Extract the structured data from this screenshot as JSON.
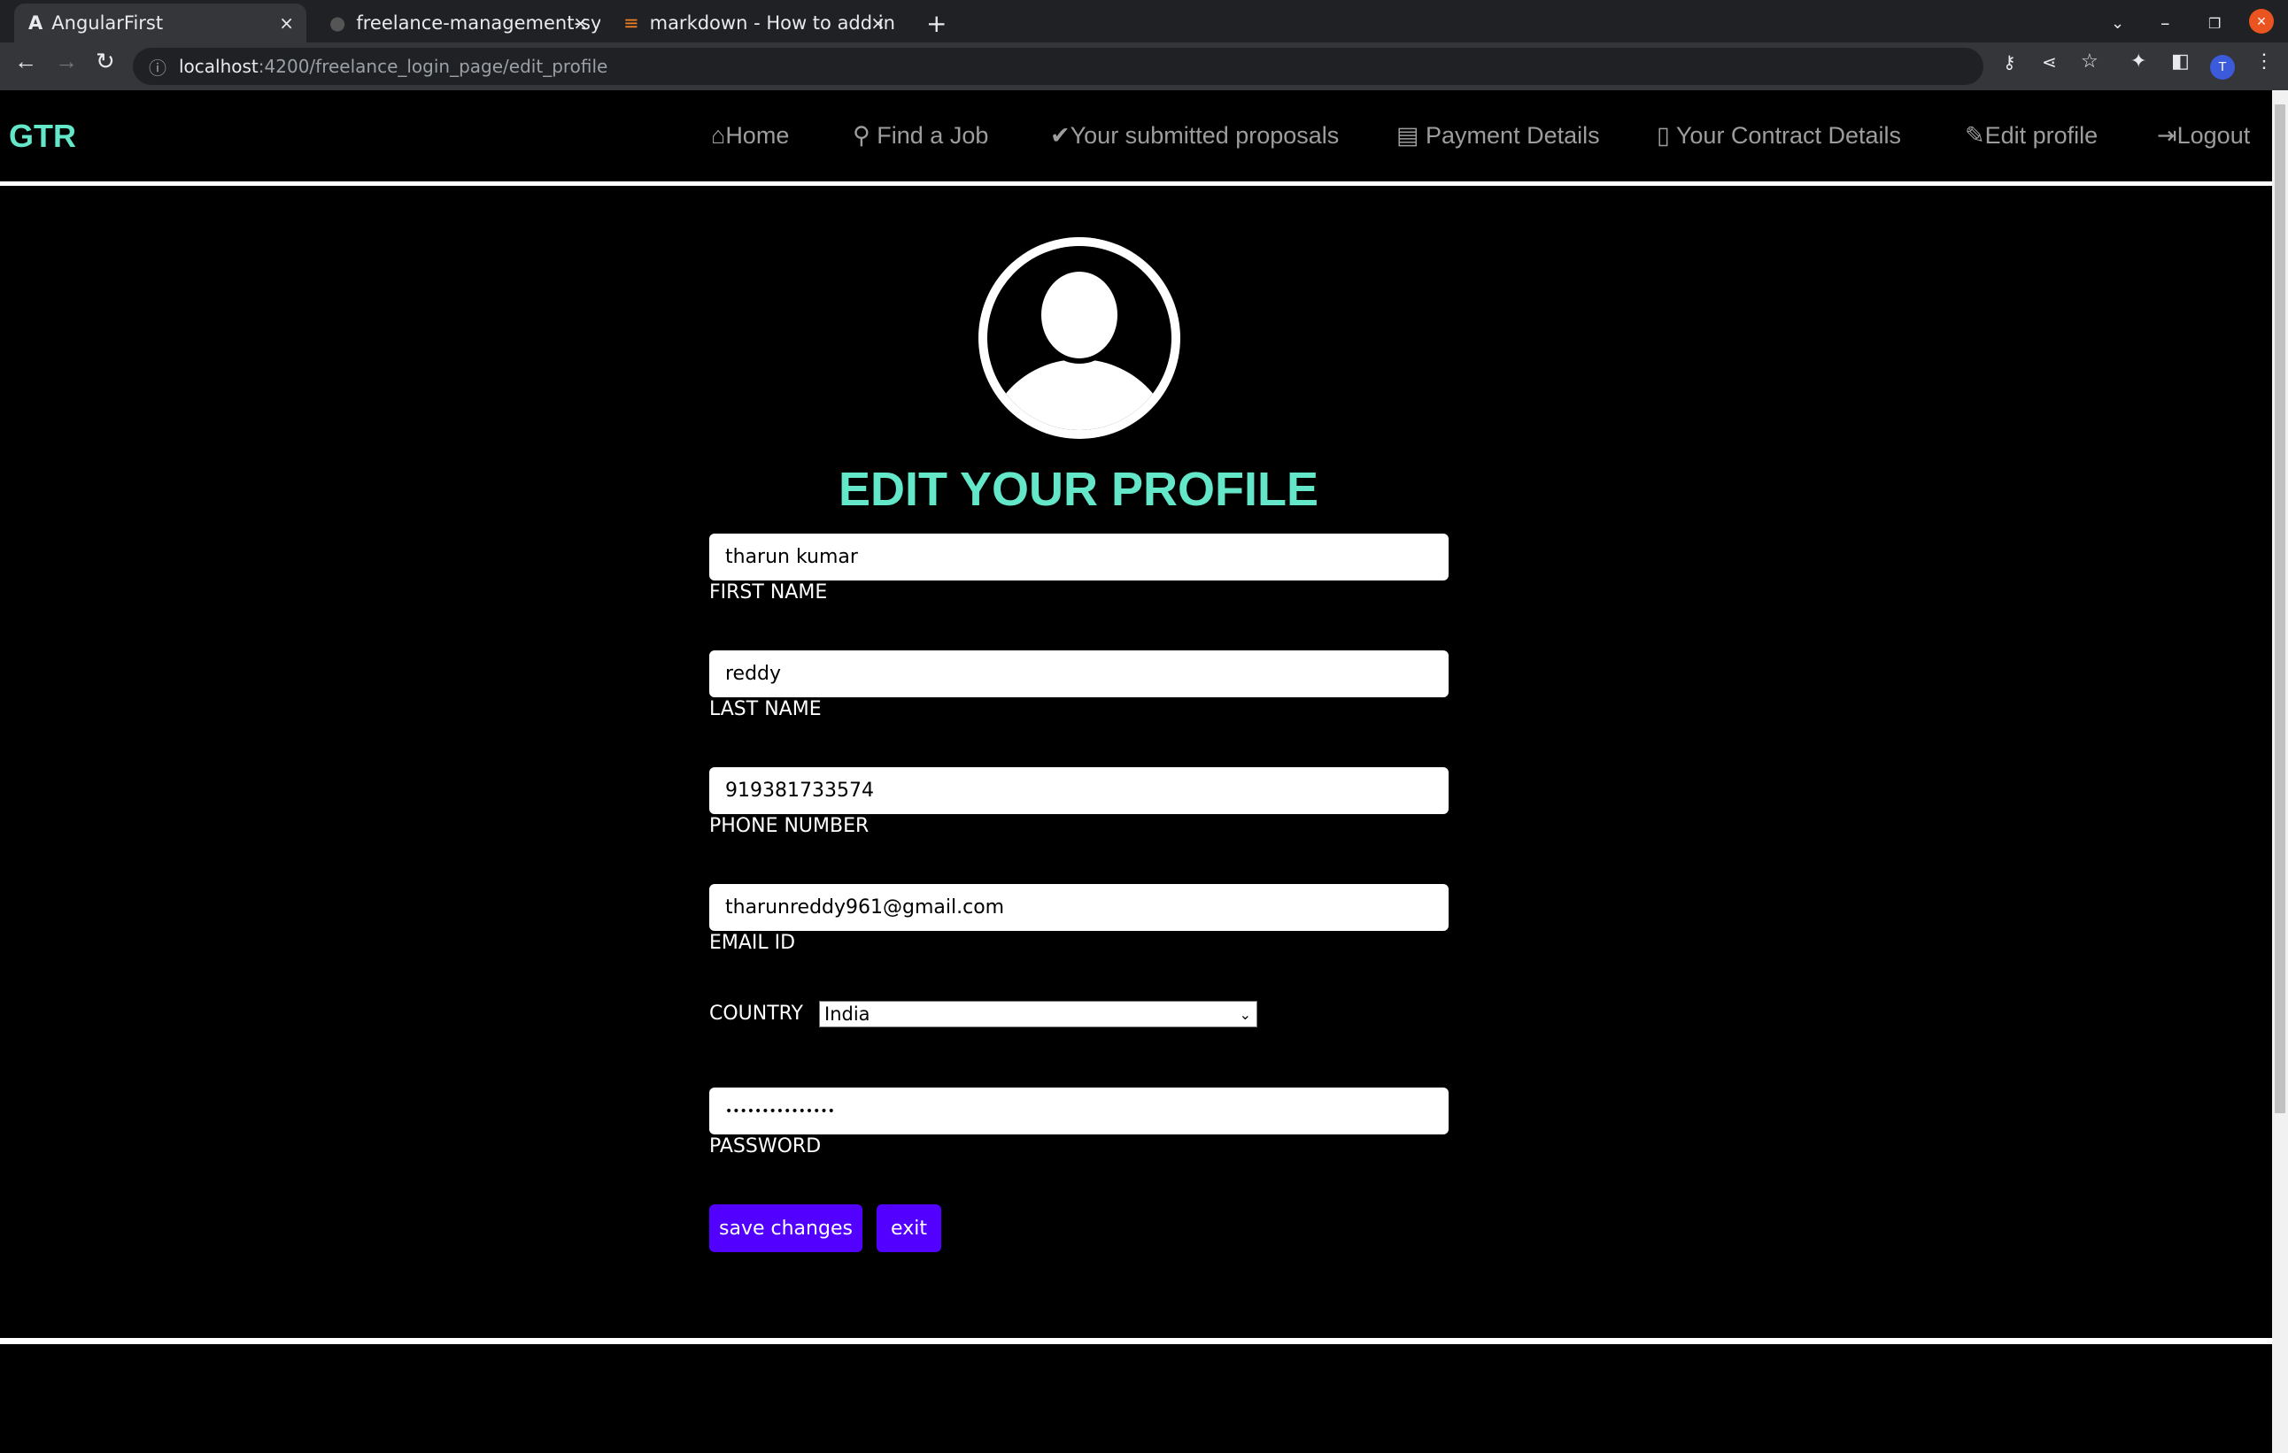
{
  "browser": {
    "tabs": [
      {
        "title": "AngularFirst"
      },
      {
        "title": "freelance-management-sy"
      },
      {
        "title": "markdown - How to add in"
      }
    ],
    "url_host": "localhost",
    "url_path": ":4200/freelance_login_page/edit_profile",
    "profile_initial": "T"
  },
  "nav": {
    "brand": "GTR",
    "items": [
      {
        "icon": "home-icon",
        "label": "Home"
      },
      {
        "icon": "search-icon",
        "label": "Find a Job"
      },
      {
        "icon": "check-icon",
        "label": "Your submitted proposals"
      },
      {
        "icon": "credit-card-icon",
        "label": "Payment Details"
      },
      {
        "icon": "file-icon",
        "label": "Your Contract Details"
      },
      {
        "icon": "edit-icon",
        "label": "Edit profile"
      },
      {
        "icon": "logout-icon",
        "label": "Logout"
      }
    ]
  },
  "form": {
    "title": "EDIT YOUR PROFILE",
    "first_name": {
      "value": "tharun kumar",
      "label": "FIRST NAME"
    },
    "last_name": {
      "value": "reddy",
      "label": "LAST NAME"
    },
    "phone": {
      "value": "919381733574",
      "label": "PHONE NUMBER"
    },
    "email": {
      "value": "tharunreddy961@gmail.com",
      "label": "EMAIL ID"
    },
    "country": {
      "label": "COUNTRY",
      "value": "India"
    },
    "password": {
      "value": "•••••••••••••••",
      "label": "PASSWORD"
    },
    "save_label": "save changes",
    "exit_label": "exit"
  },
  "colors": {
    "brand": "#64e6c8",
    "button": "#5200ff"
  }
}
